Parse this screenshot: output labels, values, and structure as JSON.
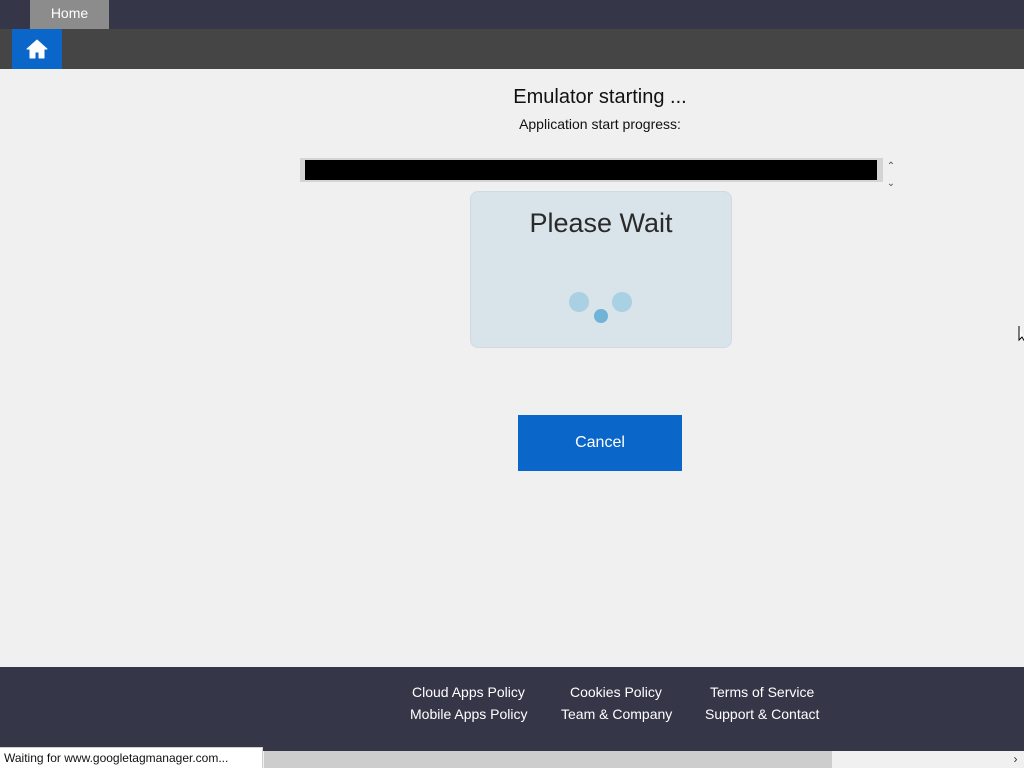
{
  "tabs": {
    "home_label": "Home"
  },
  "toolbar": {
    "home_icon": "home-icon"
  },
  "main": {
    "title": "Emulator starting ...",
    "subtitle": "Application start progress:",
    "progress_fraction": 0.99,
    "wait_text": "Please Wait",
    "cancel_label": "Cancel"
  },
  "footer": {
    "links": [
      "Cloud Apps Policy",
      "Cookies Policy",
      "Terms of Service",
      "Mobile Apps Policy",
      "Team & Company",
      "Support & Contact"
    ]
  },
  "status": {
    "text": "Waiting for www.googletagmanager.com..."
  },
  "colors": {
    "accent": "#0a66c8",
    "header_bg": "#363649",
    "toolbar_bg": "#454545",
    "footer_bg": "#363649"
  }
}
